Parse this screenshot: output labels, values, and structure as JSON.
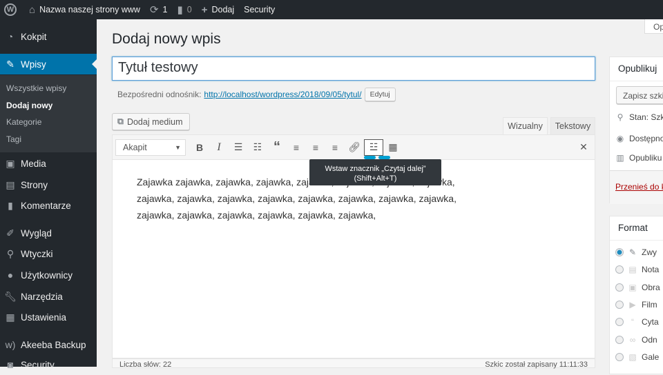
{
  "adminbar": {
    "site_name": "Nazwa naszej strony www",
    "updates": "1",
    "comments": "0",
    "add": "Dodaj",
    "security": "Security"
  },
  "sidebar": {
    "items": [
      {
        "label": "Kokpit",
        "icon": "dashboard-icon"
      },
      {
        "label": "Wpisy",
        "icon": "pin-icon"
      },
      {
        "label": "Media",
        "icon": "media-icon"
      },
      {
        "label": "Strony",
        "icon": "page-icon"
      },
      {
        "label": "Komentarze",
        "icon": "comment-icon"
      },
      {
        "label": "Wygląd",
        "icon": "brush-icon"
      },
      {
        "label": "Wtyczki",
        "icon": "plugin-icon"
      },
      {
        "label": "Użytkownicy",
        "icon": "user-icon"
      },
      {
        "label": "Narzędzia",
        "icon": "wrench-icon"
      },
      {
        "label": "Ustawienia",
        "icon": "settings-icon"
      },
      {
        "label": "Akeeba Backup",
        "icon": "akeeba-icon"
      },
      {
        "label": "Security",
        "icon": "shield-icon"
      }
    ],
    "submenu": [
      "Wszystkie wpisy",
      "Dodaj nowy",
      "Kategorie",
      "Tagi"
    ]
  },
  "page_title": "Dodaj nowy wpis",
  "post_title": "Tytuł testowy",
  "permalink": {
    "label": "Bezpośredni odnośnik:",
    "url": "http://localhost/wordpress/2018/09/05/tytul/",
    "edit": "Edytuj"
  },
  "editor": {
    "add_media": "Dodaj medium",
    "tab_visual": "Wizualny",
    "tab_text": "Tekstowy",
    "format": "Akapit",
    "content": "Zajawka zajawka, zajawka,  zajawka,  zajawka,  zajawka,  zajawka,  zajawka, zajawka,  zajawka, zajawka,  zajawka,  zajawka, zajawka,  zajawka, zajawka, zajawka,   zajawka, zajawka, zajawka, zajawka, zajawka,",
    "tooltip_line1": "Wstaw znacznik „Czytaj dalej”",
    "tooltip_line2": "(Shift+Alt+T)",
    "word_count": "Liczba słów: 22",
    "saved": "Szkic został zapisany 11:11:33"
  },
  "screen_options": "Op",
  "publish": {
    "title": "Opublikuj",
    "save_draft": "Zapisz szkic",
    "status": "Stan: Szk",
    "visibility": "Dostępno",
    "publish_date": "Opubliku",
    "trash": "Przenieś do k"
  },
  "format_box": {
    "title": "Format",
    "options": [
      "Zwy",
      "Nota",
      "Obra",
      "Film",
      "Cyta",
      "Odn",
      "Gale"
    ],
    "selected": 0
  }
}
